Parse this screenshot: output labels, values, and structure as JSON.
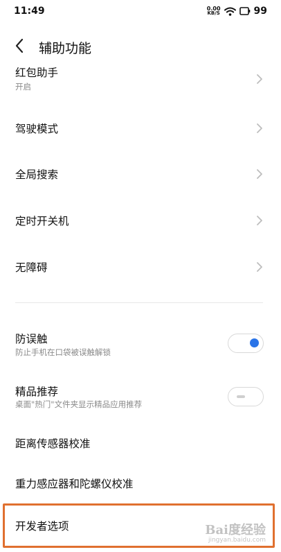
{
  "status_bar": {
    "time": "11:49",
    "net_speed_value": "0.00",
    "net_speed_unit": "KB/S",
    "battery": "99"
  },
  "header": {
    "title": "辅助功能"
  },
  "items": [
    {
      "title": "红包助手",
      "subtitle": "开启"
    },
    {
      "title": "驾驶模式"
    },
    {
      "title": "全局搜索"
    },
    {
      "title": "定时开关机"
    },
    {
      "title": "无障碍"
    }
  ],
  "toggles": [
    {
      "title": "防误触",
      "subtitle": "防止手机在口袋被误触解锁",
      "state": "on"
    },
    {
      "title": "精品推荐",
      "subtitle": "桌面\"热门\"文件夹显示精品应用推荐",
      "state": "off"
    }
  ],
  "plain_items": [
    {
      "title": "距离传感器校准"
    },
    {
      "title": "重力感应器和陀螺仪校准"
    },
    {
      "title": "开发者选项"
    }
  ],
  "watermark": {
    "main": "Bai度经验",
    "sub": "jingyan.baidu.com"
  },
  "colors": {
    "accent": "#2a74e8",
    "highlight": "#e0702f"
  }
}
